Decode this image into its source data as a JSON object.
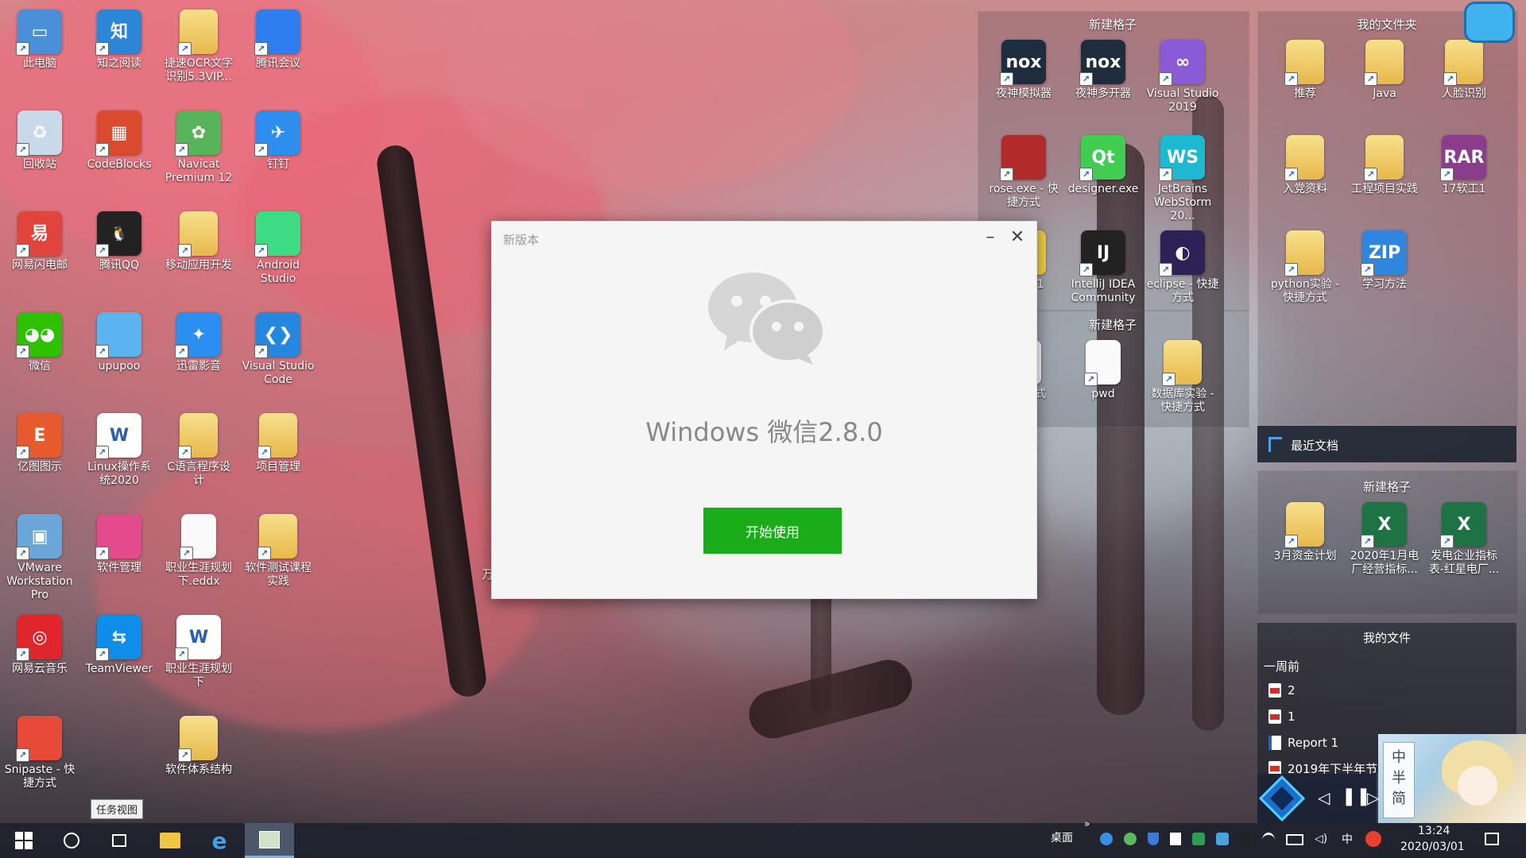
{
  "desktop": {
    "icons_col1": [
      {
        "label": "此电脑",
        "icon": "computer-icon"
      },
      {
        "label": "回收站",
        "icon": "recycle-bin-icon"
      },
      {
        "label": "网易闪电邮",
        "icon": "netease-mail-icon"
      },
      {
        "label": "微信",
        "icon": "wechat-icon"
      },
      {
        "label": "亿图图示",
        "icon": "edraw-icon"
      },
      {
        "label": "VMware Workstation Pro",
        "icon": "vmware-icon"
      },
      {
        "label": "网易云音乐",
        "icon": "netease-music-icon"
      },
      {
        "label": "Snipaste - 快捷方式",
        "icon": "snipaste-icon"
      }
    ],
    "icons_col2": [
      {
        "label": "知之阅读",
        "icon": "zhizhi-icon"
      },
      {
        "label": "CodeBlocks",
        "icon": "codeblocks-icon"
      },
      {
        "label": "腾讯QQ",
        "icon": "qq-icon"
      },
      {
        "label": "upupoo",
        "icon": "upupoo-icon"
      },
      {
        "label": "Linux操作系统2020",
        "icon": "word-doc-icon"
      },
      {
        "label": "软件管理",
        "icon": "software-manager-icon"
      },
      {
        "label": "TeamViewer",
        "icon": "teamviewer-icon"
      }
    ],
    "icons_col3": [
      {
        "label": "捷速OCR文字识别5.3VIP...",
        "icon": "folder-icon"
      },
      {
        "label": "Navicat Premium 12",
        "icon": "navicat-icon"
      },
      {
        "label": "移动应用开发",
        "icon": "folder-icon"
      },
      {
        "label": "迅雷影音",
        "icon": "xunlei-icon"
      },
      {
        "label": "C语言程序设计",
        "icon": "folder-icon"
      },
      {
        "label": "职业生涯规划下.eddx",
        "icon": "doc-icon"
      },
      {
        "label": "职业生涯规划下",
        "icon": "word-doc-icon"
      },
      {
        "label": "软件体系结构",
        "icon": "folder-icon"
      }
    ],
    "icons_col4": [
      {
        "label": "腾讯会议",
        "icon": "tencent-meeting-icon"
      },
      {
        "label": "钉钉",
        "icon": "dingtalk-icon"
      },
      {
        "label": "Android Studio",
        "icon": "android-studio-icon"
      },
      {
        "label": "Visual Studio Code",
        "icon": "vscode-icon"
      },
      {
        "label": "项目管理",
        "icon": "folder-icon"
      },
      {
        "label": "软件测试课程实践",
        "icon": "folder-icon"
      }
    ],
    "stray_text": "万"
  },
  "fences": {
    "fence1": {
      "title": "新建格子",
      "items": [
        {
          "label": "夜神模拟器",
          "icon": "nox-icon"
        },
        {
          "label": "夜神多开器",
          "icon": "nox-multi-icon"
        },
        {
          "label": "Visual Studio 2019",
          "icon": "visual-studio-icon"
        },
        {
          "label": "rose.exe - 快捷方式",
          "icon": "rose-icon"
        },
        {
          "label": "designer.exe",
          "icon": "qt-designer-icon"
        },
        {
          "label": "JetBrains WebStorm 20...",
          "icon": "webstorm-icon"
        },
        {
          "label": "s Py 01",
          "icon": "pycharm-icon"
        },
        {
          "label": "IntelliJ IDEA Community",
          "icon": "intellij-icon"
        },
        {
          "label": "eclipse - 快捷方式",
          "icon": "eclipse-icon"
        }
      ]
    },
    "fence2": {
      "title": "新建格子",
      "items": [
        {
          "label": "- 快捷 式",
          "icon": "doc-icon"
        },
        {
          "label": "pwd",
          "icon": "doc-icon"
        },
        {
          "label": "数据库实验 - 快捷方式",
          "icon": "folder-icon"
        }
      ]
    },
    "fence3": {
      "title": "我的文件夹",
      "items": [
        {
          "label": "推荐",
          "icon": "folder-icon"
        },
        {
          "label": "Java",
          "icon": "folder-icon"
        },
        {
          "label": "人脸识别",
          "icon": "folder-icon"
        },
        {
          "label": "入党资料",
          "icon": "folder-icon"
        },
        {
          "label": "工程项目实践",
          "icon": "folder-icon"
        },
        {
          "label": "17软工1",
          "icon": "rar-icon"
        },
        {
          "label": "python实验 - 快捷方式",
          "icon": "folder-icon"
        },
        {
          "label": "学习方法",
          "icon": "zip-icon"
        }
      ]
    },
    "recent_header": "最近文档",
    "fence4": {
      "title": "新建格子",
      "items": [
        {
          "label": "3月资金计划",
          "icon": "folder-icon"
        },
        {
          "label": "2020年1月电厂经营指标...",
          "icon": "excel-icon"
        },
        {
          "label": "发电企业指标表-红星电厂...",
          "icon": "excel-icon"
        }
      ]
    },
    "myfiles": {
      "title": "我的文件",
      "group": "一周前",
      "rows": [
        "2",
        "1",
        "Report 1",
        "2019年下半年节"
      ]
    }
  },
  "dialog": {
    "title": "新版本",
    "product": "Windows 微信2.8.0",
    "start_button": "开始使用",
    "minimize": "–",
    "close": "✕"
  },
  "ime": [
    "中",
    "半",
    "简"
  ],
  "tooltip": "任务视图",
  "taskbar": {
    "desktop_label": "桌面",
    "ime_indicator": "中",
    "time": "13:24",
    "date": "2020/03/01"
  },
  "colors": {
    "wechat_green": "#1aad19"
  }
}
